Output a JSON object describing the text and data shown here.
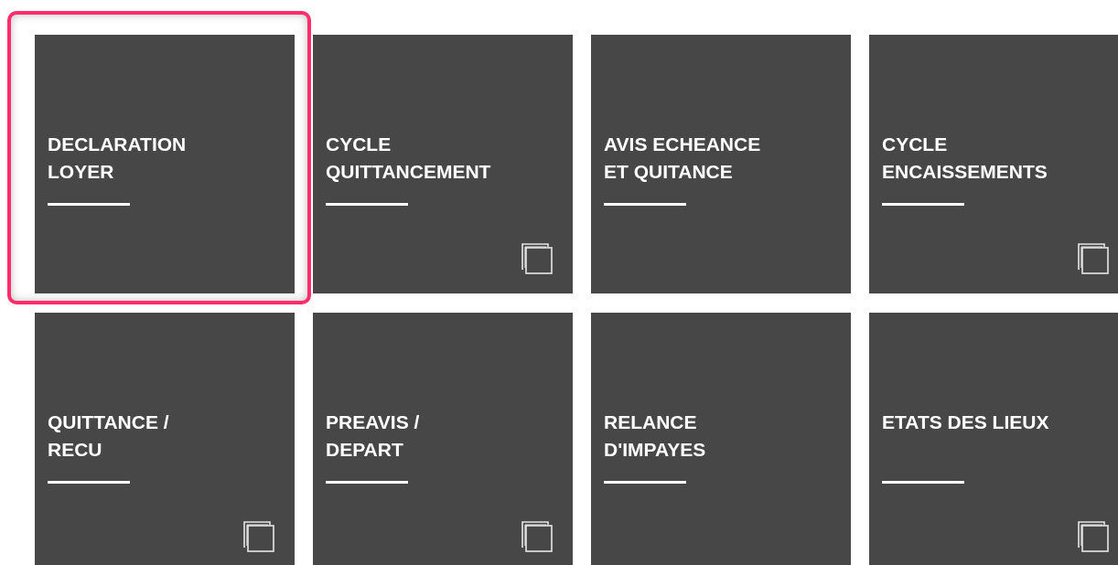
{
  "tiles": [
    {
      "lines": [
        "DECLARATION",
        "LOYER"
      ],
      "selected": true,
      "copy_icon": false
    },
    {
      "lines": [
        "CYCLE",
        "QUITTANCEMENT"
      ],
      "selected": false,
      "copy_icon": true
    },
    {
      "lines": [
        "AVIS ECHEANCE",
        "ET QUITANCE"
      ],
      "selected": false,
      "copy_icon": false
    },
    {
      "lines": [
        "CYCLE",
        "ENCAISSEMENTS"
      ],
      "selected": false,
      "copy_icon": true
    },
    {
      "lines": [
        "QUITTANCE /",
        "RECU"
      ],
      "selected": false,
      "copy_icon": true
    },
    {
      "lines": [
        "PREAVIS /",
        "DEPART"
      ],
      "selected": false,
      "copy_icon": true
    },
    {
      "lines": [
        "RELANCE",
        "D'IMPAYES"
      ],
      "selected": false,
      "copy_icon": false
    },
    {
      "lines": [
        "ETATS DES LIEUX"
      ],
      "selected": false,
      "copy_icon": true
    }
  ]
}
